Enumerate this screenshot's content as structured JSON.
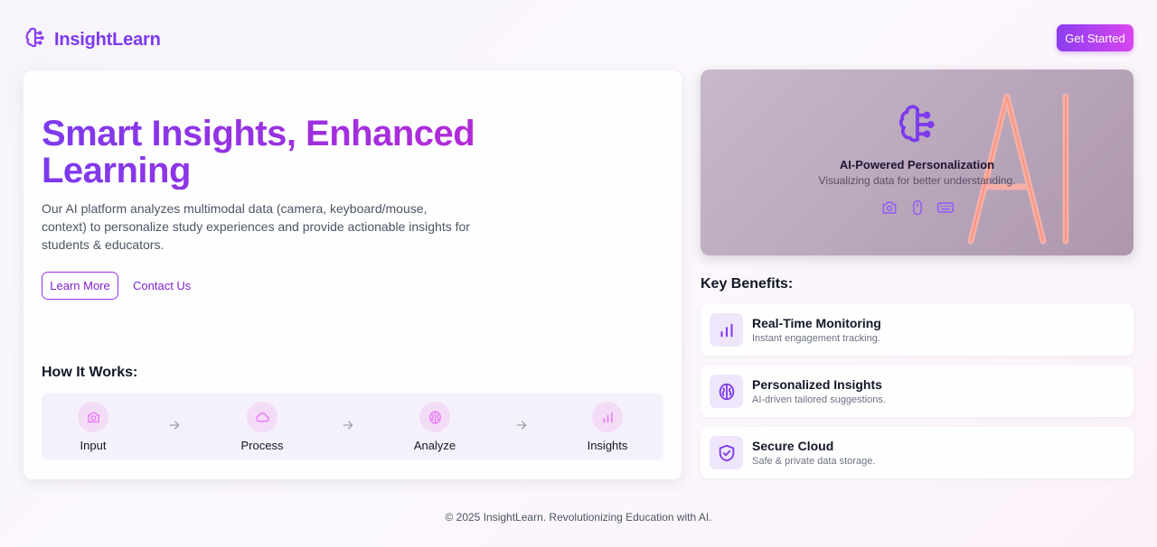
{
  "brand": {
    "name": "InsightLearn",
    "logo_icon": "brain-icon",
    "accent": "#7c3aed",
    "accent_pink": "#d946ef"
  },
  "header": {
    "cta_label": "Get Started"
  },
  "hero": {
    "title": "Smart Insights, Enhanced Learning",
    "description": "Our AI platform analyzes multimodal data (camera, keyboard/mouse, context) to personalize study experiences and provide actionable insights for students & educators.",
    "learn_more_label": "Learn More",
    "contact_label": "Contact Us"
  },
  "how_it_works": {
    "title": "How It Works:",
    "steps": [
      {
        "label": "Input",
        "icon": "camera-icon"
      },
      {
        "label": "Process",
        "icon": "cloud-icon"
      },
      {
        "label": "Analyze",
        "icon": "brain-icon"
      },
      {
        "label": "Insights",
        "icon": "bar-chart-icon"
      }
    ]
  },
  "ai_card": {
    "title": "AI-Powered Personalization",
    "subtitle": "Visualizing data for better understanding.",
    "icons": [
      "camera-icon",
      "mouse-icon",
      "keyboard-icon"
    ]
  },
  "benefits": {
    "title": "Key Benefits:",
    "items": [
      {
        "title": "Real-Time Monitoring",
        "subtitle": "Instant engagement tracking.",
        "icon": "bar-chart-icon"
      },
      {
        "title": "Personalized Insights",
        "subtitle": "AI-driven tailored suggestions.",
        "icon": "brain-icon"
      },
      {
        "title": "Secure Cloud",
        "subtitle": "Safe & private data storage.",
        "icon": "shield-check-icon"
      }
    ]
  },
  "footer": {
    "text": "© 2025 InsightLearn. Revolutionizing Education with AI."
  }
}
